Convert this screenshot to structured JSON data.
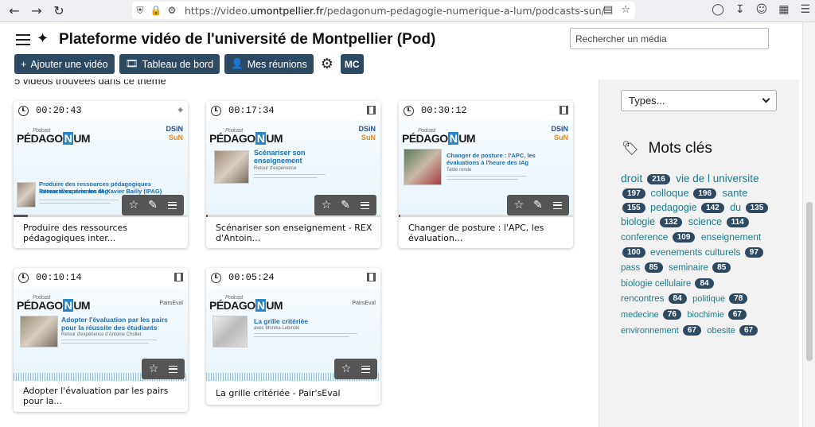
{
  "browser": {
    "url_prefix": "https://video.",
    "url_domain": "umontpellier.fr",
    "url_path": "/pedagonum-pedagogie-numerique-a-lum/podcasts-sun/"
  },
  "header": {
    "title": "Plateforme vidéo de l'université de Montpellier (Pod)",
    "search_placeholder": "Rechercher un média"
  },
  "toolbar": {
    "add_video": "Ajouter une vidéo",
    "dashboard": "Tableau de bord",
    "meetings": "Mes réunions",
    "user_initials": "MC"
  },
  "results": {
    "count_text": "5 vidéos trouvées dans ce thème"
  },
  "cards": [
    {
      "duration": "00:20:43",
      "caption": "Produire des ressources pédagogiques inter...",
      "thumb_title": "Produire des ressources pédagogiques interactives avec les IAg",
      "thumb_sub": "Retour d'expérience de Xavier Bailly (IPAG)",
      "pre": "Podcast",
      "brand_a": "PÉDAGO",
      "brand_n": "N",
      "brand_b": "UM",
      "logo_a": "DSiN",
      "logo_b": "SuN"
    },
    {
      "duration": "00:17:34",
      "caption": "Scénariser son enseignement - REX d'Antoin...",
      "thumb_title": "Scénariser son enseignement",
      "thumb_sub": "Retour d'expérience",
      "pre": "Podcast",
      "brand_a": "PÉDAGO",
      "brand_n": "N",
      "brand_b": "UM",
      "logo_a": "DSiN",
      "logo_b": "SuN"
    },
    {
      "duration": "00:30:12",
      "caption": "Changer de posture : l'APC, les évaluation...",
      "thumb_title": "Changer de posture : l'APC, les évaluations à l'heure des IAg",
      "thumb_sub": "Table ronde",
      "pre": "Podcast",
      "brand_a": "PÉDAGO",
      "brand_n": "N",
      "brand_b": "UM",
      "logo_a": "DSiN",
      "logo_b": "SuN"
    },
    {
      "duration": "00:10:14",
      "caption": "Adopter l'évaluation par les pairs pour la...",
      "thumb_title": "Adopter l'évaluation par les pairs pour la réussite des étudiants",
      "thumb_sub": "Retour d'expérience d'Antoine Chollet",
      "pre": "Podcast",
      "brand_a": "PÉDAGO",
      "brand_n": "N",
      "brand_b": "UM",
      "logo_a": "",
      "logo_b": "PairsEval"
    },
    {
      "duration": "00:05:24",
      "caption": "La grille critériée - Pair'sEval",
      "thumb_title": "La grille critériée",
      "thumb_sub": "avec Monika Lubinski",
      "pre": "Podcast",
      "brand_a": "PÉDAGO",
      "brand_n": "N",
      "brand_b": "UM",
      "logo_a": "",
      "logo_b": "PairsEval"
    }
  ],
  "sidebar": {
    "types_placeholder": "Types...",
    "tags_heading": "Mots clés",
    "tags": [
      {
        "label": "droit",
        "count": "216"
      },
      {
        "label": "vie de l universite",
        "count": "197"
      },
      {
        "label": "colloque",
        "count": "196"
      },
      {
        "label": "sante",
        "count": "155"
      },
      {
        "label": "pedagogie",
        "count": "142"
      },
      {
        "label": "du",
        "count": "135"
      },
      {
        "label": "biologie",
        "count": "132"
      },
      {
        "label": "science",
        "count": "114"
      },
      {
        "label": "conference",
        "count": "109"
      },
      {
        "label": "enseignement",
        "count": "100"
      },
      {
        "label": "evenements culturels",
        "count": "97"
      },
      {
        "label": "pass",
        "count": "85"
      },
      {
        "label": "seminaire",
        "count": "85"
      },
      {
        "label": "biologie cellulaire",
        "count": "84"
      },
      {
        "label": "rencontres",
        "count": "84"
      },
      {
        "label": "politique",
        "count": "78"
      },
      {
        "label": "medecine",
        "count": "76"
      },
      {
        "label": "biochimie",
        "count": "67"
      },
      {
        "label": "environnement",
        "count": "67"
      },
      {
        "label": "obesite",
        "count": "67"
      }
    ]
  }
}
